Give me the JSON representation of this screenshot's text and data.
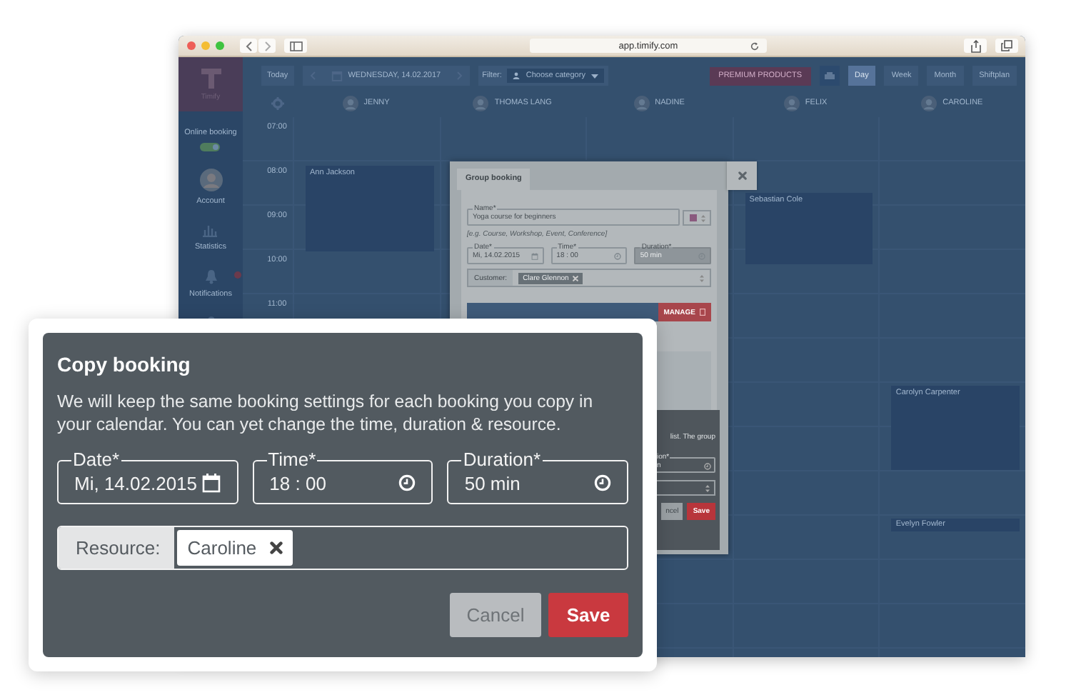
{
  "browser": {
    "address": "app.timify.com"
  },
  "sidebar": {
    "logo": "Timify",
    "online_booking": {
      "label": "Online booking",
      "on": true
    },
    "items": [
      {
        "label": "Account",
        "kind": "avatar"
      },
      {
        "label": "Statistics",
        "kind": "chart"
      },
      {
        "label": "Notifications",
        "kind": "bell"
      },
      {
        "kind": "person"
      }
    ]
  },
  "toolbar": {
    "today": "Today",
    "date": "WEDNESDAY, 14.02.2017",
    "filter_label": "Filter:",
    "filter_value": "Choose category",
    "premium": "PREMIUM PRODUCTS",
    "views": [
      {
        "label": "Day",
        "selected": true
      },
      {
        "label": "Week",
        "selected": false
      },
      {
        "label": "Month",
        "selected": false
      },
      {
        "label": "Shiftplan",
        "selected": false
      }
    ]
  },
  "resources": [
    {
      "name": "JENNY",
      "bookings": [
        {
          "customer": "Ann Jackson"
        }
      ]
    },
    {
      "name": "THOMAS LANG"
    },
    {
      "name": "NADINE"
    },
    {
      "name": "FELIX",
      "bookings": [
        {
          "customer": "Sebastian Cole"
        }
      ]
    },
    {
      "name": "CAROLINE",
      "bookings": [
        {
          "customer": "Carolyn Carpenter"
        },
        {
          "customer": "Evelyn Fowler"
        }
      ]
    }
  ],
  "times": [
    "07:00",
    "08:00",
    "09:00",
    "10:00",
    "11:00"
  ],
  "group_booking": {
    "tab": "Group booking",
    "name": {
      "label": "Name*",
      "value": "Yoga course for beginners"
    },
    "hint": "[e.g. Course, Workshop, Event, Conference]",
    "fields": [
      {
        "label": "Date*",
        "value": "Mi, 14.02.2015",
        "kind": "date",
        "disabled": false
      },
      {
        "label": "Time*",
        "value": "18 : 00",
        "kind": "time",
        "disabled": false
      },
      {
        "label": "Duration*",
        "value": "50 min",
        "kind": "time",
        "disabled": true
      }
    ],
    "customer": {
      "label": "Customer:",
      "tags": [
        "Clare Glennon"
      ]
    },
    "manage": "MANAGE",
    "partial": {
      "text": "list. The group",
      "field_label": "ion*",
      "field_value": "n",
      "cancel": "ncel",
      "save": "Save"
    }
  },
  "copy_dialog": {
    "title": "Copy booking",
    "description": "We will keep the same booking settings for each booking you copy in your calendar. You can yet change the time, duration & resource.",
    "fields": [
      {
        "label": "Date*",
        "value": "Mi, 14.02.2015",
        "kind": "date"
      },
      {
        "label": "Time*",
        "value": "18 : 00",
        "kind": "time"
      },
      {
        "label": "Duration*",
        "value": "50 min",
        "kind": "time"
      }
    ],
    "resource": {
      "label": "Resource:",
      "tags": [
        "Caroline"
      ]
    },
    "buttons": [
      {
        "label": "Cancel",
        "kind": "secondary"
      },
      {
        "label": "Save",
        "kind": "primary"
      }
    ]
  }
}
